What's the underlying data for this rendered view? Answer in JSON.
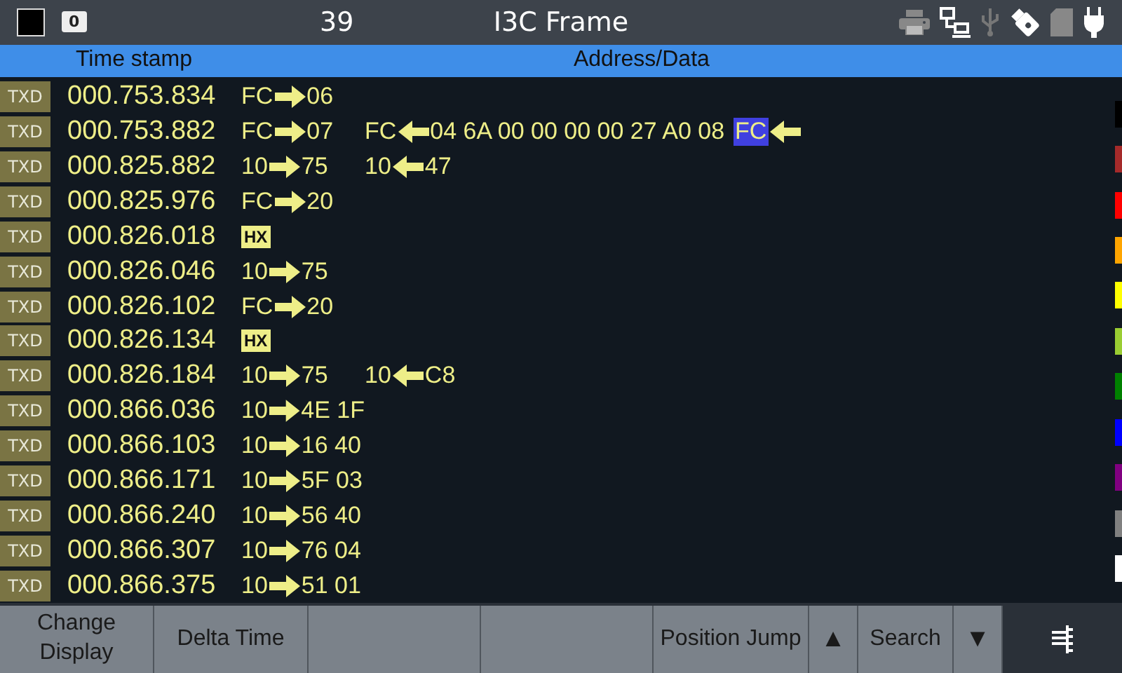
{
  "top_bar": {
    "badge": "0",
    "count": "39",
    "title": "I3C Frame"
  },
  "header": {
    "columns": [
      "Time stamp",
      "Address/Data"
    ]
  },
  "rows": [
    {
      "tag": "TXD",
      "time": "000.753.834",
      "segments": [
        {
          "kind": "write",
          "addr": "FC",
          "data": "06"
        }
      ]
    },
    {
      "tag": "TXD",
      "time": "000.753.882",
      "segments": [
        {
          "kind": "write",
          "addr": "FC",
          "data": "07"
        },
        {
          "kind": "read",
          "addr": "FC",
          "data": "04 6A 00 00 00 00 27 A0 08"
        },
        {
          "kind": "read",
          "addr": "FC",
          "highlighted": true
        }
      ]
    },
    {
      "tag": "TXD",
      "time": "000.825.882",
      "segments": [
        {
          "kind": "write",
          "addr": "10",
          "data": "75"
        },
        {
          "kind": "read",
          "addr": "10",
          "data": "47"
        }
      ]
    },
    {
      "tag": "TXD",
      "time": "000.825.976",
      "segments": [
        {
          "kind": "write",
          "addr": "FC",
          "data": "20"
        }
      ]
    },
    {
      "tag": "TXD",
      "time": "000.826.018",
      "segments": [
        {
          "kind": "hx",
          "label": "HX"
        }
      ]
    },
    {
      "tag": "TXD",
      "time": "000.826.046",
      "segments": [
        {
          "kind": "write",
          "addr": "10",
          "data": "75"
        }
      ]
    },
    {
      "tag": "TXD",
      "time": "000.826.102",
      "segments": [
        {
          "kind": "write",
          "addr": "FC",
          "data": "20"
        }
      ]
    },
    {
      "tag": "TXD",
      "time": "000.826.134",
      "segments": [
        {
          "kind": "hx",
          "label": "HX"
        }
      ]
    },
    {
      "tag": "TXD",
      "time": "000.826.184",
      "segments": [
        {
          "kind": "write",
          "addr": "10",
          "data": "75"
        },
        {
          "kind": "read",
          "addr": "10",
          "data": "C8"
        }
      ]
    },
    {
      "tag": "TXD",
      "time": "000.866.036",
      "segments": [
        {
          "kind": "write",
          "addr": "10",
          "data": "4E 1F"
        }
      ]
    },
    {
      "tag": "TXD",
      "time": "000.866.103",
      "segments": [
        {
          "kind": "write",
          "addr": "10",
          "data": "16 40"
        }
      ]
    },
    {
      "tag": "TXD",
      "time": "000.866.171",
      "segments": [
        {
          "kind": "write",
          "addr": "10",
          "data": "5F 03"
        }
      ]
    },
    {
      "tag": "TXD",
      "time": "000.866.240",
      "segments": [
        {
          "kind": "write",
          "addr": "10",
          "data": "56 40"
        }
      ]
    },
    {
      "tag": "TXD",
      "time": "000.866.307",
      "segments": [
        {
          "kind": "write",
          "addr": "10",
          "data": "76 04"
        }
      ]
    },
    {
      "tag": "TXD",
      "time": "000.866.375",
      "segments": [
        {
          "kind": "write",
          "addr": "10",
          "data": "51 01"
        }
      ]
    }
  ],
  "color_marks": [
    {
      "color": "#000000"
    },
    {
      "color": "#a52a2a"
    },
    {
      "color": "#ff0000"
    },
    {
      "color": "#ffa500"
    },
    {
      "color": "#ffff00"
    },
    {
      "color": "#9acd32"
    },
    {
      "color": "#008000"
    },
    {
      "color": "#0000ff"
    },
    {
      "color": "#800080"
    },
    {
      "color": "#808080"
    },
    {
      "color": "#ffffff"
    }
  ],
  "soft_keys": [
    {
      "kind": "text",
      "label": "Change Display"
    },
    {
      "kind": "text",
      "label": "Delta Time"
    },
    {
      "kind": "blank"
    },
    {
      "kind": "blank"
    },
    {
      "kind": "text",
      "label": "Position Jump"
    },
    {
      "kind": "glyph",
      "label": "▲"
    },
    {
      "kind": "text",
      "label": "Search"
    },
    {
      "kind": "glyph",
      "label": "▼"
    },
    {
      "kind": "menu"
    }
  ]
}
